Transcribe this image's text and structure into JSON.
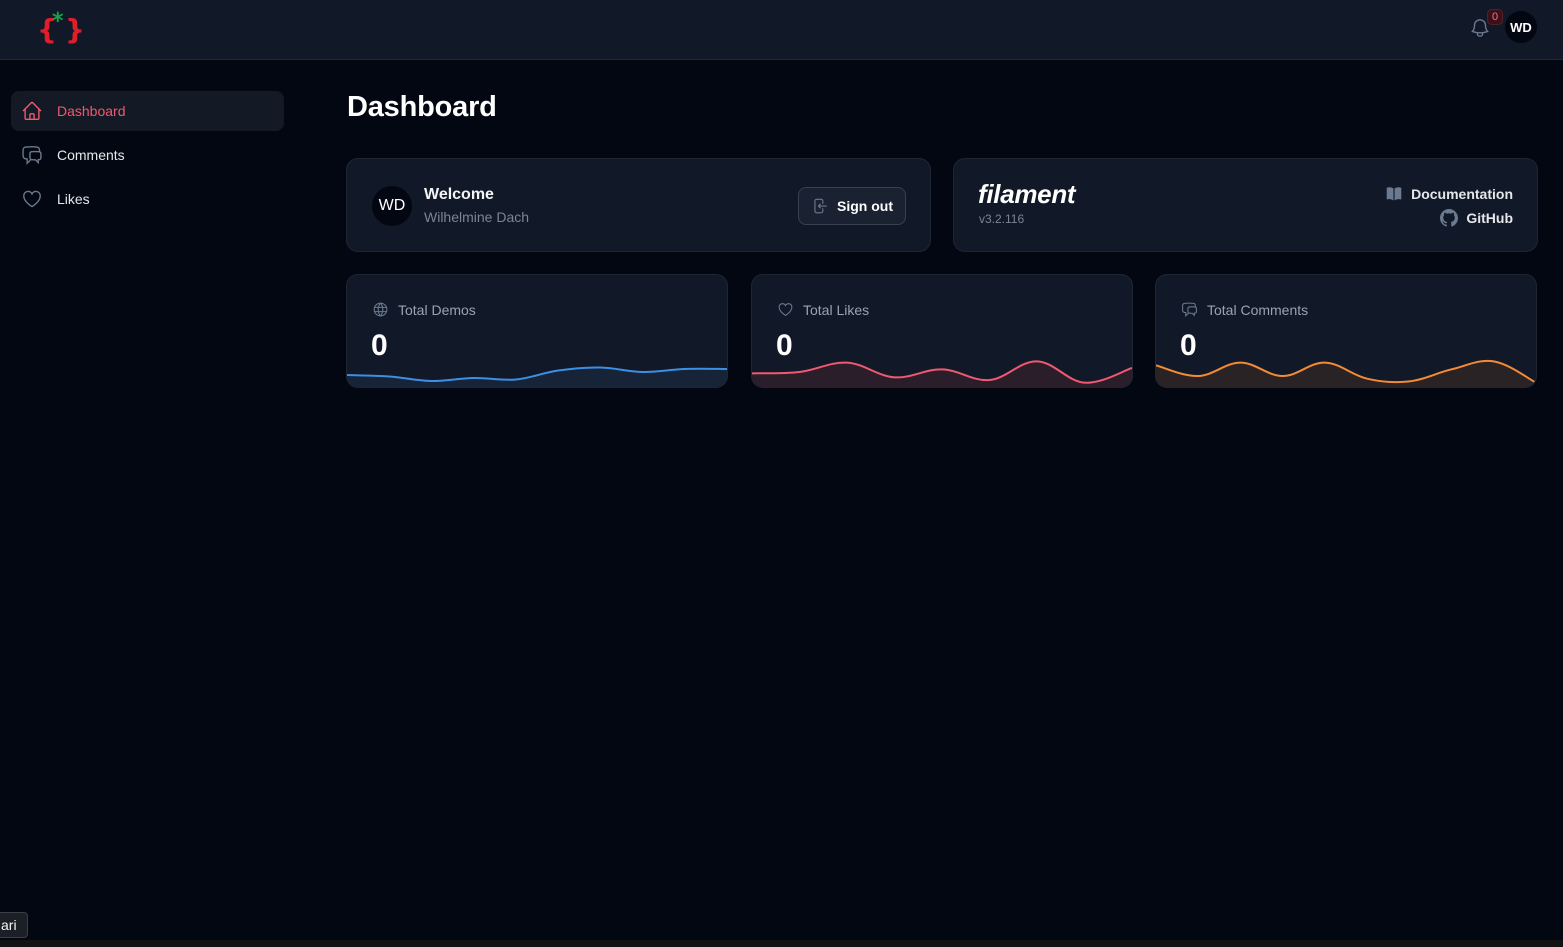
{
  "topbar": {
    "logo_alt": "app-logo",
    "notifications_count": "0",
    "user_initials": "WD",
    "colors": {
      "logo_brace": "#e11d2a",
      "logo_star": "#16a34a"
    }
  },
  "sidebar": {
    "items": [
      {
        "label": "Dashboard",
        "icon": "home-icon",
        "active": true
      },
      {
        "label": "Comments",
        "icon": "chat-bubbles-icon",
        "active": false
      },
      {
        "label": "Likes",
        "icon": "heart-icon",
        "active": false
      }
    ]
  },
  "page": {
    "title": "Dashboard"
  },
  "welcome": {
    "initials": "WD",
    "title": "Welcome",
    "name": "Wilhelmine Dach",
    "signout_label": "Sign out"
  },
  "filament": {
    "brand": "filament",
    "version": "v3.2.116",
    "documentation_label": "Documentation",
    "github_label": "GitHub"
  },
  "stats": [
    {
      "label": "Total Demos",
      "value": "0",
      "icon": "globe-icon",
      "color": "#3b8fe4",
      "fill": "#172337"
    },
    {
      "label": "Total Likes",
      "value": "0",
      "icon": "heart-icon",
      "color": "#f0596f",
      "fill": "#2a1e2a"
    },
    {
      "label": "Total Comments",
      "value": "0",
      "icon": "chat-bubbles-icon",
      "color": "#f58a35",
      "fill": "#2a2326"
    }
  ],
  "chart_data": [
    {
      "type": "area",
      "title": "Total Demos",
      "values": [
        6,
        5,
        2,
        4,
        3,
        9,
        11,
        8,
        10,
        10
      ],
      "ylim": [
        0,
        16
      ]
    },
    {
      "type": "area",
      "title": "Total Likes",
      "values": [
        8,
        9,
        16,
        5,
        11,
        3,
        17,
        1,
        12
      ],
      "ylim": [
        0,
        18
      ]
    },
    {
      "type": "area",
      "title": "Total Comments",
      "values": [
        14,
        6,
        16,
        6,
        16,
        4,
        2,
        11,
        17,
        1
      ],
      "ylim": [
        0,
        18
      ]
    }
  ],
  "tooltip": {
    "text": "ari"
  }
}
